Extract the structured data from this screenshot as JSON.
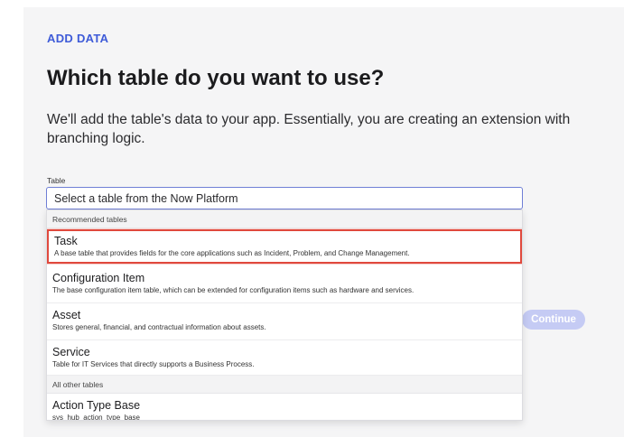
{
  "header": {
    "eyebrow": "ADD DATA",
    "title": "Which table do you want to use?",
    "description": "We'll add the table's data to your app. Essentially, you are creating an extension with branching logic."
  },
  "table_field": {
    "label": "Table",
    "placeholder": "Select a table from the Now Platform",
    "value": ""
  },
  "dropdown": {
    "recommended_header": "Recommended tables",
    "recommended": [
      {
        "title": "Task",
        "description": "A base table that provides fields for the core applications such as Incident, Problem, and Change Management."
      },
      {
        "title": "Configuration Item",
        "description": "The base configuration item table, which can be extended for configuration items such as hardware and services."
      },
      {
        "title": "Asset",
        "description": "Stores general, financial, and contractual information about assets."
      },
      {
        "title": "Service",
        "description": "Table for IT Services that directly supports a Business Process."
      }
    ],
    "other_header": "All other tables",
    "other": [
      {
        "title": "Action Type Base",
        "description": "sys_hub_action_type_base"
      }
    ]
  },
  "footer": {
    "continue_label": "Continue"
  },
  "colors": {
    "accent": "#3e5bd8",
    "highlight_border": "#e0493d",
    "continue_disabled": "#c5cbf4"
  }
}
